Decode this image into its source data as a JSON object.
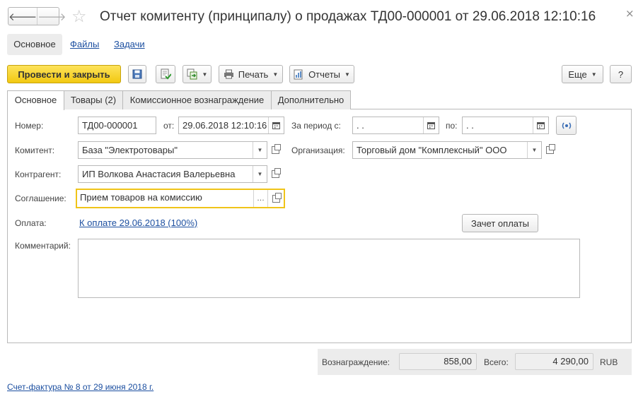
{
  "window": {
    "title": "Отчет комитенту (принципалу) о продажах ТД00-000001 от 29.06.2018 12:10:16",
    "back_glyph": "🡐",
    "fwd_glyph": "🡒",
    "star_glyph": "☆",
    "close_glyph": "×"
  },
  "sections": {
    "main": "Основное",
    "files": "Файлы",
    "tasks": "Задачи"
  },
  "toolbar": {
    "post_close": "Провести и закрыть",
    "print": "Печать",
    "reports": "Отчеты",
    "more": "Еще",
    "help": "?"
  },
  "tabs": [
    {
      "label": "Основное",
      "active": true
    },
    {
      "label": "Товары (2)",
      "active": false
    },
    {
      "label": "Комиссионное вознаграждение",
      "active": false
    },
    {
      "label": "Дополнительно",
      "active": false
    }
  ],
  "form": {
    "number_label": "Номер:",
    "number_value": "ТД00-000001",
    "from_label": "от:",
    "date_value": "29.06.2018 12:10:16",
    "period_from_label": "За период с:",
    "period_from_value": " .  .",
    "period_to_label": "по:",
    "period_to_value": " .  .",
    "committent_label": "Комитент:",
    "committent_value": "База \"Электротовары\"",
    "org_label": "Организация:",
    "org_value": "Торговый дом \"Комплексный\" ООО",
    "counterparty_label": "Контрагент:",
    "counterparty_value": "ИП Волкова Анастасия Валерьевна",
    "agreement_label": "Соглашение:",
    "agreement_value": "Прием товаров на комиссию",
    "payment_label": "Оплата:",
    "payment_link": "К оплате 29.06.2018 (100%)",
    "payment_offset_button": "Зачет оплаты",
    "comment_label": "Комментарий:",
    "comment_value": ""
  },
  "totals": {
    "reward_label": "Вознаграждение:",
    "reward_value": "858,00",
    "total_label": "Всего:",
    "total_value": "4 290,00",
    "currency": "RUB"
  },
  "invoice_link": "Счет-фактура № 8 от 29 июня 2018 г.",
  "colors": {
    "primary_button": "#f2c811",
    "link": "#1c4fa0",
    "highlight_border": "#f0c419"
  }
}
